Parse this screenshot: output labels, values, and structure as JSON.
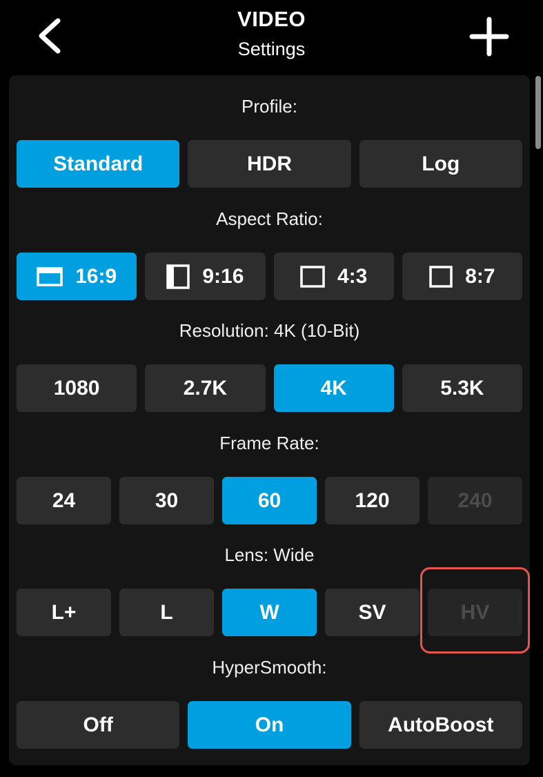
{
  "header": {
    "title": "VIDEO",
    "subtitle": "Settings",
    "back_icon": "chevron-left-icon",
    "add_icon": "plus-icon"
  },
  "colors": {
    "selected": "#00a0e0",
    "option_bg": "#2d2d2d",
    "disabled_text": "#4c4c4c",
    "highlight": "#e5554a"
  },
  "profile": {
    "label": "Profile:",
    "options": [
      {
        "label": "Standard",
        "selected": true
      },
      {
        "label": "HDR",
        "selected": false
      },
      {
        "label": "Log",
        "selected": false
      }
    ]
  },
  "aspect_ratio": {
    "label": "Aspect Ratio:",
    "options": [
      {
        "label": "16:9",
        "icon": "landscape-frame-icon",
        "selected": true
      },
      {
        "label": "9:16",
        "icon": "portrait-frame-icon",
        "selected": false
      },
      {
        "label": "4:3",
        "icon": "standard-frame-icon",
        "selected": false
      },
      {
        "label": "8:7",
        "icon": "square-frame-icon",
        "selected": false
      }
    ]
  },
  "resolution": {
    "label": "Resolution: 4K (10-Bit)",
    "options": [
      {
        "label": "1080",
        "selected": false
      },
      {
        "label": "2.7K",
        "selected": false
      },
      {
        "label": "4K",
        "selected": true
      },
      {
        "label": "5.3K",
        "selected": false
      }
    ]
  },
  "frame_rate": {
    "label": "Frame Rate:",
    "options": [
      {
        "label": "24",
        "selected": false
      },
      {
        "label": "30",
        "selected": false
      },
      {
        "label": "60",
        "selected": true
      },
      {
        "label": "120",
        "selected": false
      },
      {
        "label": "240",
        "selected": false,
        "disabled": true
      }
    ]
  },
  "lens": {
    "label": "Lens: Wide",
    "options": [
      {
        "label": "L+",
        "selected": false
      },
      {
        "label": "L",
        "selected": false
      },
      {
        "label": "W",
        "selected": true
      },
      {
        "label": "SV",
        "selected": false
      },
      {
        "label": "HV",
        "selected": false,
        "disabled": true,
        "highlighted": true
      }
    ]
  },
  "hypersmooth": {
    "label": "HyperSmooth:",
    "options": [
      {
        "label": "Off",
        "selected": false
      },
      {
        "label": "On",
        "selected": true
      },
      {
        "label": "AutoBoost",
        "selected": false
      }
    ]
  }
}
